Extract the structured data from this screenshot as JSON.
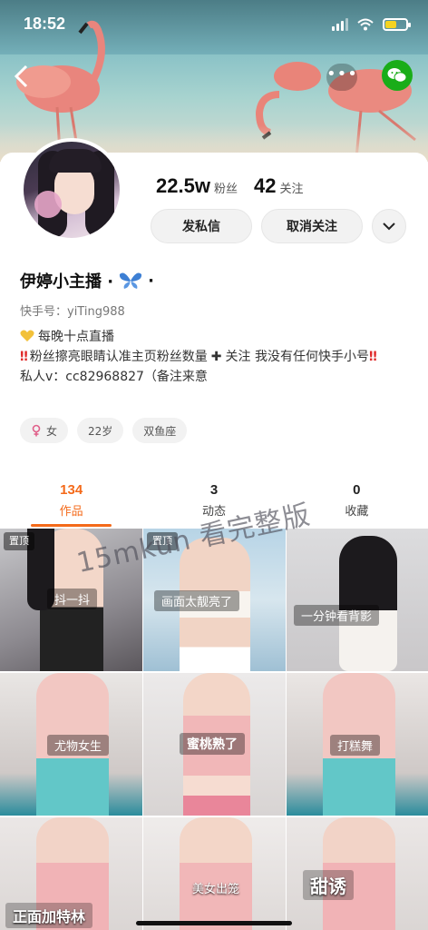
{
  "status_bar": {
    "time": "18:52",
    "battery_color": "#f5d321"
  },
  "profile": {
    "followers_count": "22.5w",
    "followers_label": "粉丝",
    "following_count": "42",
    "following_label": "关注",
    "message_button": "发私信",
    "unfollow_button": "取消关注",
    "name": "伊婷小主播 ·",
    "name_suffix": "·",
    "account": "快手号：yiTing988",
    "bio_line1": "每晚十点直播",
    "bio_line2a": "粉丝擦亮眼睛认准主页粉丝数量",
    "bio_line2b": "关注 我没有任何快手小号",
    "bio_line3": "私人v：cc82968827（备注来意",
    "tags": [
      "女",
      "22岁",
      "双鱼座"
    ]
  },
  "tabs": [
    {
      "count": "134",
      "label": "作品",
      "active": true
    },
    {
      "count": "3",
      "label": "动态",
      "active": false
    },
    {
      "count": "0",
      "label": "收藏",
      "active": false
    }
  ],
  "grid": {
    "pin_label": "置顶",
    "captions": [
      "抖一抖",
      "画面太靓亮了",
      "一分钟看背影",
      "尤物女生",
      "蜜桃熟了",
      "打糕舞",
      "正面加特林",
      "美女出笼",
      "甜诱"
    ]
  },
  "watermark": "15mkun 看完整版",
  "colors": {
    "accent": "#f46a1a",
    "alert_red": "#e02b2b",
    "wechat_green": "#1aad19"
  }
}
